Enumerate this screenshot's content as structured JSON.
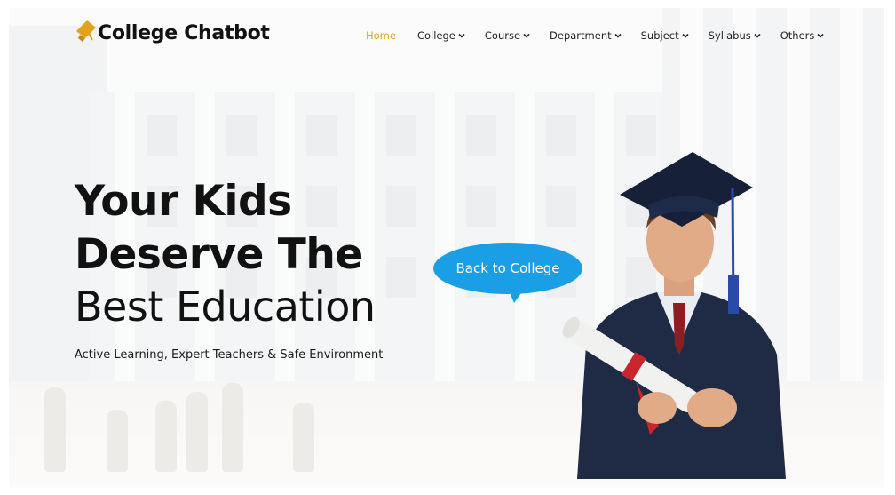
{
  "brand": {
    "name": "College Chatbot",
    "icon": "graduation-cap-icon",
    "accent": "#e2a21a"
  },
  "nav": {
    "items": [
      {
        "label": "Home",
        "active": true
      },
      {
        "label": "College",
        "active": false
      },
      {
        "label": "Course",
        "active": false
      },
      {
        "label": "Department",
        "active": false
      },
      {
        "label": "Subject",
        "active": false
      },
      {
        "label": "Syllabus",
        "active": false
      },
      {
        "label": "Others",
        "active": false
      }
    ]
  },
  "hero": {
    "line1": "Your Kids",
    "line2": "Deserve The",
    "line3": "Best Education",
    "tagline": "Active Learning, Expert Teachers & Safe Environment",
    "bubble_label": "Back to College",
    "bubble_color": "#1a9fe6"
  }
}
